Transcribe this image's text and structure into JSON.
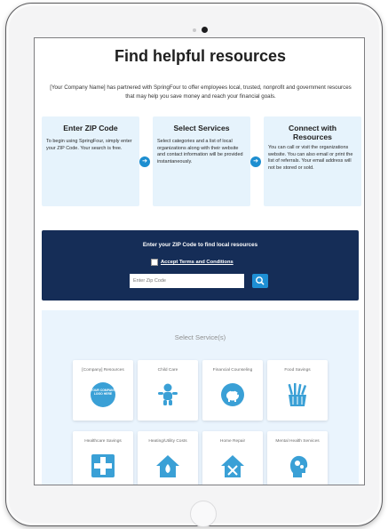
{
  "page": {
    "title": "Find helpful resources",
    "intro": "[Your Company Name] has partnered with SpringFour to offer employees local, trusted, nonprofit and government resources that may help you save money and reach your financial goals."
  },
  "steps": [
    {
      "title": "Enter ZIP Code",
      "text": "To begin using SpringFour, simply enter your ZIP Code. Your search is free."
    },
    {
      "title": "Select Services",
      "text": "Select categories and a list of local organizations along with their website and contact information will be provided instantaneously."
    },
    {
      "title": "Connect with Resources",
      "text": "You can call or visit the organizations website. You can also email or print the list of referrals. Your email address will not be stored or sold."
    }
  ],
  "zip_search": {
    "heading": "Enter your ZIP Code to find local resources",
    "terms_label": "Accept Terms and Conditions",
    "terms_checked": false,
    "input_placeholder": "Enter Zip Code",
    "input_value": ""
  },
  "services": {
    "heading": "Select Service(s)",
    "company_logo_text": "YOUR COMPANY LOGO HERE",
    "tiles": [
      {
        "label": "[Company] Resources",
        "icon": "company-logo"
      },
      {
        "label": "Child Care",
        "icon": "child-icon"
      },
      {
        "label": "Financial Counseling",
        "icon": "piggy-bank-icon"
      },
      {
        "label": "Food Savings",
        "icon": "grocery-bag-icon"
      },
      {
        "label": "Healthcare Savings",
        "icon": "medical-cross-icon"
      },
      {
        "label": "Heating/Utility Costs",
        "icon": "house-flame-icon"
      },
      {
        "label": "Home Repair",
        "icon": "house-tools-icon"
      },
      {
        "label": "Mental Health Services",
        "icon": "head-gears-icon"
      }
    ]
  },
  "colors": {
    "accent": "#1d8ed0",
    "banner": "#152d57",
    "step_bg": "#e6f3fc",
    "services_bg": "#eaf4fd",
    "icon": "#3aa0d6"
  }
}
